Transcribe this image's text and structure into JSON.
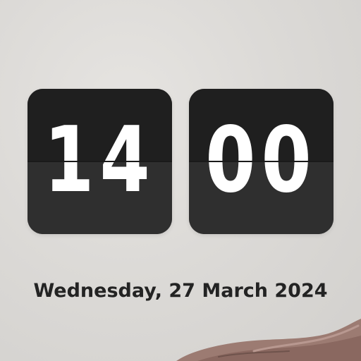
{
  "clock": {
    "hours": "14",
    "minutes": "00"
  },
  "date": {
    "text": "Wednesday, 27 March 2024"
  },
  "colors": {
    "background": "#dcdad7",
    "tile_top": "#1f1f1f",
    "tile_bottom": "#2f2f2f",
    "digit": "#ffffff",
    "date_text": "#232323"
  },
  "decoration": {
    "icon": "wallpaper-object-corner"
  }
}
